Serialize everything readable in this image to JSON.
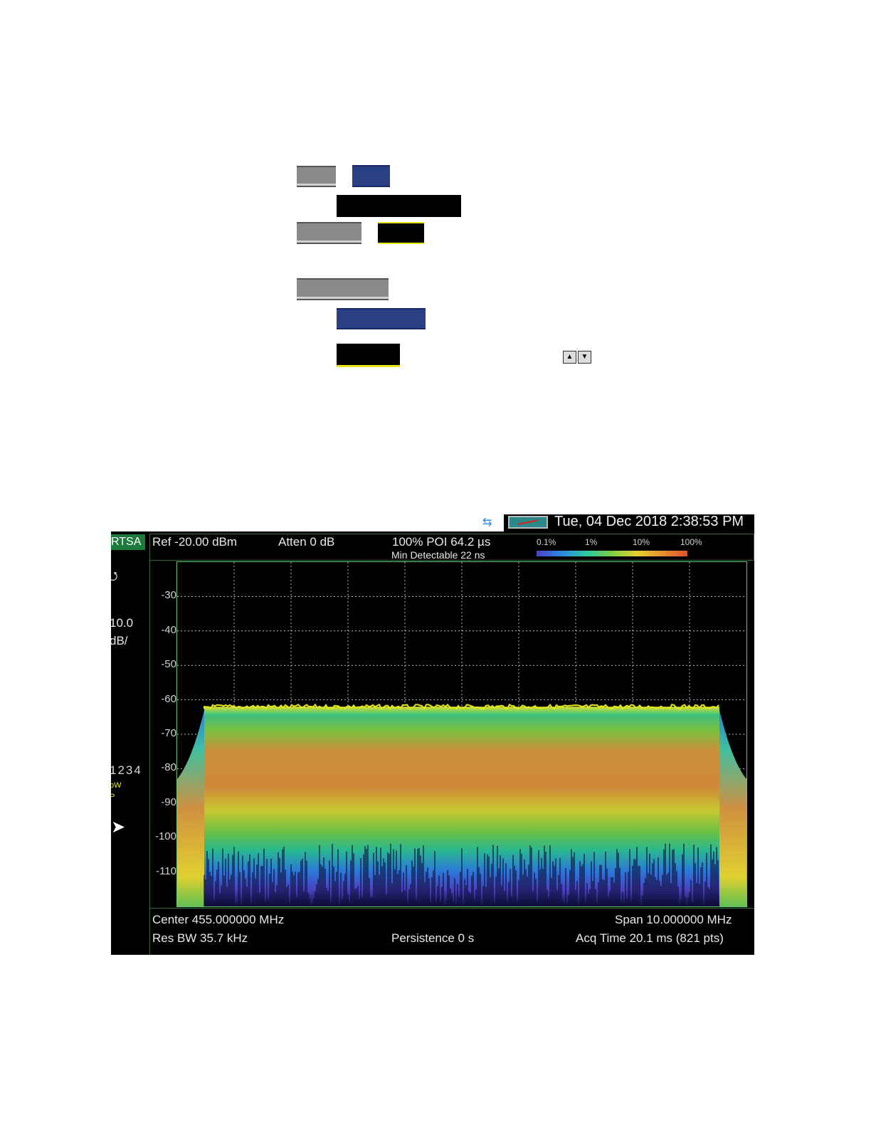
{
  "instrument": {
    "datetime": "Tue, 04 Dec 2018 2:38:53 PM",
    "mode": "RTSA",
    "ref_level": "Ref -20.00 dBm",
    "atten": "Atten 0 dB",
    "poi": "100% POI 64.2 µs",
    "min_detectable": "Min Detectable 22 ns",
    "scale_value": "10.0",
    "scale_unit": "dB/",
    "trace_numbers": "1234",
    "trace_flag1": "pW",
    "trace_flag2": "P",
    "colorbar_labels": [
      "0.1%",
      "1%",
      "10%",
      "100%"
    ],
    "center": "Center 455.000000 MHz",
    "span": "Span 10.000000 MHz",
    "res_bw": "Res BW 35.7 kHz",
    "persistence": "Persistence 0  s",
    "acq_time": "Acq Time 20.1 ms (821 pts)",
    "y_ticks": [
      "-30",
      "-40",
      "-50",
      "-60",
      "-70",
      "-80",
      "-90",
      "-100",
      "-110"
    ]
  },
  "colors": {
    "accent_green": "#1c7a3c",
    "redacted_blue": "#2b3f84",
    "redacted_gray": "#8a8a8a",
    "trace_yellow": "#e6e619"
  },
  "icons": {
    "network": "network-icon",
    "battery": "battery-icon",
    "cursor": "mouse-cursor-icon",
    "arrows": [
      "up-arrow-icon",
      "down-arrow-icon"
    ]
  },
  "chart_data": {
    "type": "heatmap",
    "title": "",
    "xlabel": "",
    "ylabel": "",
    "y_ticks": [
      -30,
      -40,
      -50,
      -60,
      -70,
      -80,
      -90,
      -100,
      -110
    ],
    "ylim": [
      -120,
      -20
    ],
    "x_center_mhz": 455.0,
    "span_mhz": 10.0,
    "grid": true,
    "signal_top_dbm": -62,
    "signal_band": [
      -110,
      -62
    ]
  }
}
